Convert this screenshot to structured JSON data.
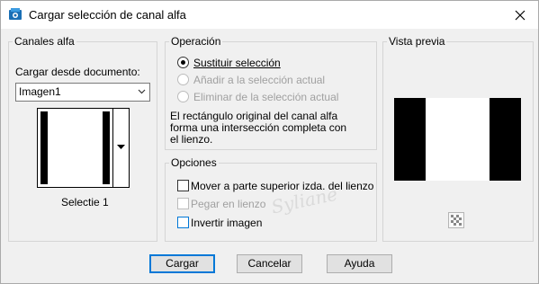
{
  "window": {
    "title": "Cargar selección de canal alfa"
  },
  "alpha_channels": {
    "group_title": "Canales alfa",
    "load_from_label": "Cargar desde documento:",
    "document_value": "Imagen1",
    "selection_name": "Selectie 1"
  },
  "operation": {
    "group_title": "Operación",
    "options": [
      {
        "label": "Sustituir selección",
        "selected": true,
        "enabled": true
      },
      {
        "label": "Añadir a la selección actual",
        "selected": false,
        "enabled": false
      },
      {
        "label": "Eliminar de la selección actual",
        "selected": false,
        "enabled": false
      }
    ],
    "description": [
      "El rectángulo original del canal alfa",
      "forma una intersección completa con",
      "el lienzo."
    ]
  },
  "options": {
    "group_title": "Opciones",
    "move_top_left": "Mover a parte superior izda. del lienzo",
    "paste_canvas": "Pegar en lienzo",
    "invert_image": "Invertir imagen"
  },
  "preview": {
    "group_title": "Vista previa"
  },
  "buttons": {
    "load": "Cargar",
    "cancel": "Cancelar",
    "help": "Ayuda"
  },
  "watermark": "Syliane",
  "colors": {
    "accent": "#0078d7",
    "border": "#d5d5d5",
    "background": "#f0f0f0"
  }
}
